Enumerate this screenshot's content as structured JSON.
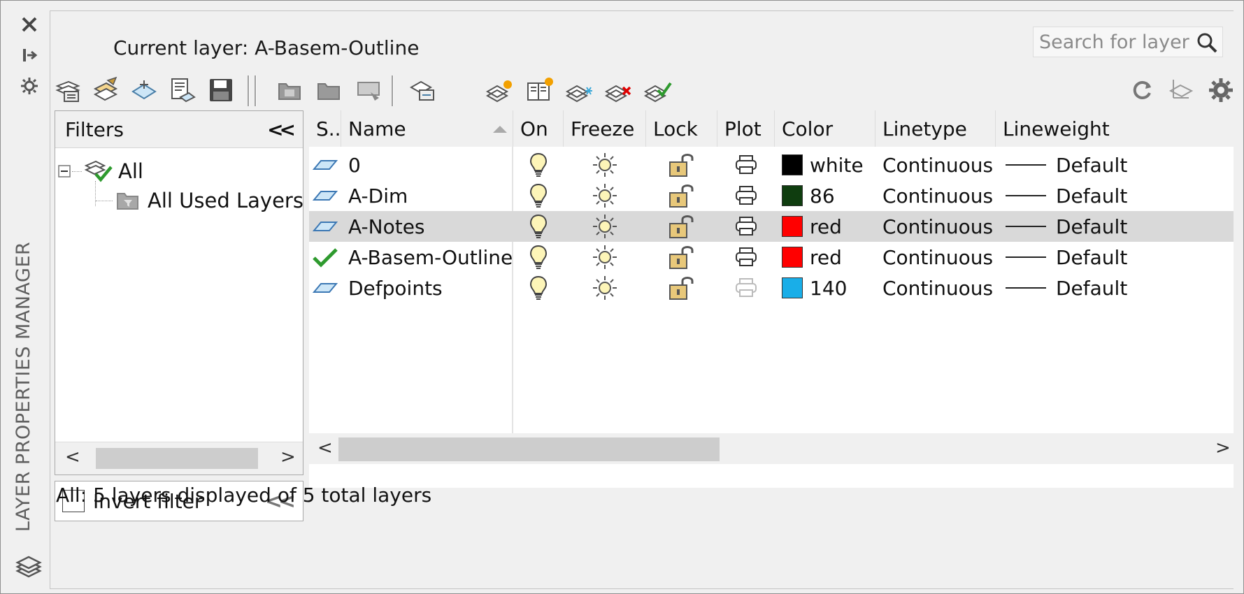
{
  "titlebar": {
    "vertical_title": "LAYER PROPERTIES MANAGER",
    "icons": [
      "close-icon",
      "auto-hide-icon",
      "properties-icon",
      "layers-stack-icon"
    ]
  },
  "header": {
    "current_layer_text": "Current layer: A-Basem-Outline",
    "search_placeholder": "Search for layer"
  },
  "toolbar": {
    "left_icons": [
      "new-property-filter-icon",
      "new-group-filter-icon",
      "layer-states-manager-icon",
      "layer-states-icon",
      "save-icon"
    ],
    "middle_icons": [
      "new-folder-icon",
      "open-folder-icon",
      "layer-ui-icon",
      "layer-merge-icon"
    ],
    "layer_icons": [
      "new-layer-icon",
      "new-layer-vp-frozen-icon",
      "new-layer-frozen-icon",
      "delete-layer-icon",
      "set-current-icon"
    ],
    "right_icons": [
      "refresh-icon",
      "layer-translate-icon",
      "settings-icon"
    ]
  },
  "filters": {
    "title": "Filters",
    "tree": [
      {
        "label": "All",
        "icon": "all-layers-filter-icon"
      },
      {
        "label": "All Used Layers",
        "icon": "used-layers-filter-icon"
      }
    ],
    "invert_label": "Invert filter"
  },
  "grid": {
    "columns": [
      "S..",
      "Name",
      "On",
      "Freeze",
      "Lock",
      "Plot",
      "Color",
      "Linetype",
      "Lineweight"
    ],
    "rows": [
      {
        "status": "layer-icon",
        "name": "0",
        "color_hex": "#000000",
        "color_name": "white",
        "linetype": "Continuous",
        "lineweight": "Default",
        "plot": true,
        "selected": false
      },
      {
        "status": "layer-icon",
        "name": "A-Dim",
        "color_hex": "#0f3d0f",
        "color_name": "86",
        "linetype": "Continuous",
        "lineweight": "Default",
        "plot": true,
        "selected": false
      },
      {
        "status": "layer-icon",
        "name": "A-Notes",
        "color_hex": "#ff0000",
        "color_name": "red",
        "linetype": "Continuous",
        "lineweight": "Default",
        "plot": true,
        "selected": true
      },
      {
        "status": "current-check-icon",
        "name": "A-Basem-Outline",
        "color_hex": "#ff0000",
        "color_name": "red",
        "linetype": "Continuous",
        "lineweight": "Default",
        "plot": true,
        "selected": false
      },
      {
        "status": "layer-icon",
        "name": "Defpoints",
        "color_hex": "#19aee8",
        "color_name": "140",
        "linetype": "Continuous",
        "lineweight": "Default",
        "plot": false,
        "selected": false
      }
    ]
  },
  "status_text": "All: 5 layers displayed of 5 total layers"
}
